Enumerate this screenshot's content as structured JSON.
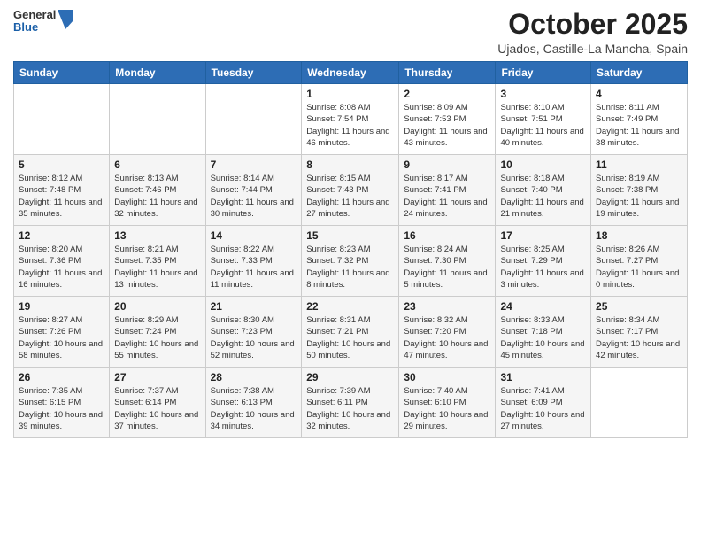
{
  "header": {
    "logo_general": "General",
    "logo_blue": "Blue",
    "title": "October 2025",
    "subtitle": "Ujados, Castille-La Mancha, Spain"
  },
  "days": [
    "Sunday",
    "Monday",
    "Tuesday",
    "Wednesday",
    "Thursday",
    "Friday",
    "Saturday"
  ],
  "weeks": [
    [
      {
        "day": "",
        "info": ""
      },
      {
        "day": "",
        "info": ""
      },
      {
        "day": "",
        "info": ""
      },
      {
        "day": "1",
        "info": "Sunrise: 8:08 AM\nSunset: 7:54 PM\nDaylight: 11 hours\nand 46 minutes."
      },
      {
        "day": "2",
        "info": "Sunrise: 8:09 AM\nSunset: 7:53 PM\nDaylight: 11 hours\nand 43 minutes."
      },
      {
        "day": "3",
        "info": "Sunrise: 8:10 AM\nSunset: 7:51 PM\nDaylight: 11 hours\nand 40 minutes."
      },
      {
        "day": "4",
        "info": "Sunrise: 8:11 AM\nSunset: 7:49 PM\nDaylight: 11 hours\nand 38 minutes."
      }
    ],
    [
      {
        "day": "5",
        "info": "Sunrise: 8:12 AM\nSunset: 7:48 PM\nDaylight: 11 hours\nand 35 minutes."
      },
      {
        "day": "6",
        "info": "Sunrise: 8:13 AM\nSunset: 7:46 PM\nDaylight: 11 hours\nand 32 minutes."
      },
      {
        "day": "7",
        "info": "Sunrise: 8:14 AM\nSunset: 7:44 PM\nDaylight: 11 hours\nand 30 minutes."
      },
      {
        "day": "8",
        "info": "Sunrise: 8:15 AM\nSunset: 7:43 PM\nDaylight: 11 hours\nand 27 minutes."
      },
      {
        "day": "9",
        "info": "Sunrise: 8:17 AM\nSunset: 7:41 PM\nDaylight: 11 hours\nand 24 minutes."
      },
      {
        "day": "10",
        "info": "Sunrise: 8:18 AM\nSunset: 7:40 PM\nDaylight: 11 hours\nand 21 minutes."
      },
      {
        "day": "11",
        "info": "Sunrise: 8:19 AM\nSunset: 7:38 PM\nDaylight: 11 hours\nand 19 minutes."
      }
    ],
    [
      {
        "day": "12",
        "info": "Sunrise: 8:20 AM\nSunset: 7:36 PM\nDaylight: 11 hours\nand 16 minutes."
      },
      {
        "day": "13",
        "info": "Sunrise: 8:21 AM\nSunset: 7:35 PM\nDaylight: 11 hours\nand 13 minutes."
      },
      {
        "day": "14",
        "info": "Sunrise: 8:22 AM\nSunset: 7:33 PM\nDaylight: 11 hours\nand 11 minutes."
      },
      {
        "day": "15",
        "info": "Sunrise: 8:23 AM\nSunset: 7:32 PM\nDaylight: 11 hours\nand 8 minutes."
      },
      {
        "day": "16",
        "info": "Sunrise: 8:24 AM\nSunset: 7:30 PM\nDaylight: 11 hours\nand 5 minutes."
      },
      {
        "day": "17",
        "info": "Sunrise: 8:25 AM\nSunset: 7:29 PM\nDaylight: 11 hours\nand 3 minutes."
      },
      {
        "day": "18",
        "info": "Sunrise: 8:26 AM\nSunset: 7:27 PM\nDaylight: 11 hours\nand 0 minutes."
      }
    ],
    [
      {
        "day": "19",
        "info": "Sunrise: 8:27 AM\nSunset: 7:26 PM\nDaylight: 10 hours\nand 58 minutes."
      },
      {
        "day": "20",
        "info": "Sunrise: 8:29 AM\nSunset: 7:24 PM\nDaylight: 10 hours\nand 55 minutes."
      },
      {
        "day": "21",
        "info": "Sunrise: 8:30 AM\nSunset: 7:23 PM\nDaylight: 10 hours\nand 52 minutes."
      },
      {
        "day": "22",
        "info": "Sunrise: 8:31 AM\nSunset: 7:21 PM\nDaylight: 10 hours\nand 50 minutes."
      },
      {
        "day": "23",
        "info": "Sunrise: 8:32 AM\nSunset: 7:20 PM\nDaylight: 10 hours\nand 47 minutes."
      },
      {
        "day": "24",
        "info": "Sunrise: 8:33 AM\nSunset: 7:18 PM\nDaylight: 10 hours\nand 45 minutes."
      },
      {
        "day": "25",
        "info": "Sunrise: 8:34 AM\nSunset: 7:17 PM\nDaylight: 10 hours\nand 42 minutes."
      }
    ],
    [
      {
        "day": "26",
        "info": "Sunrise: 7:35 AM\nSunset: 6:15 PM\nDaylight: 10 hours\nand 39 minutes."
      },
      {
        "day": "27",
        "info": "Sunrise: 7:37 AM\nSunset: 6:14 PM\nDaylight: 10 hours\nand 37 minutes."
      },
      {
        "day": "28",
        "info": "Sunrise: 7:38 AM\nSunset: 6:13 PM\nDaylight: 10 hours\nand 34 minutes."
      },
      {
        "day": "29",
        "info": "Sunrise: 7:39 AM\nSunset: 6:11 PM\nDaylight: 10 hours\nand 32 minutes."
      },
      {
        "day": "30",
        "info": "Sunrise: 7:40 AM\nSunset: 6:10 PM\nDaylight: 10 hours\nand 29 minutes."
      },
      {
        "day": "31",
        "info": "Sunrise: 7:41 AM\nSunset: 6:09 PM\nDaylight: 10 hours\nand 27 minutes."
      },
      {
        "day": "",
        "info": ""
      }
    ]
  ]
}
